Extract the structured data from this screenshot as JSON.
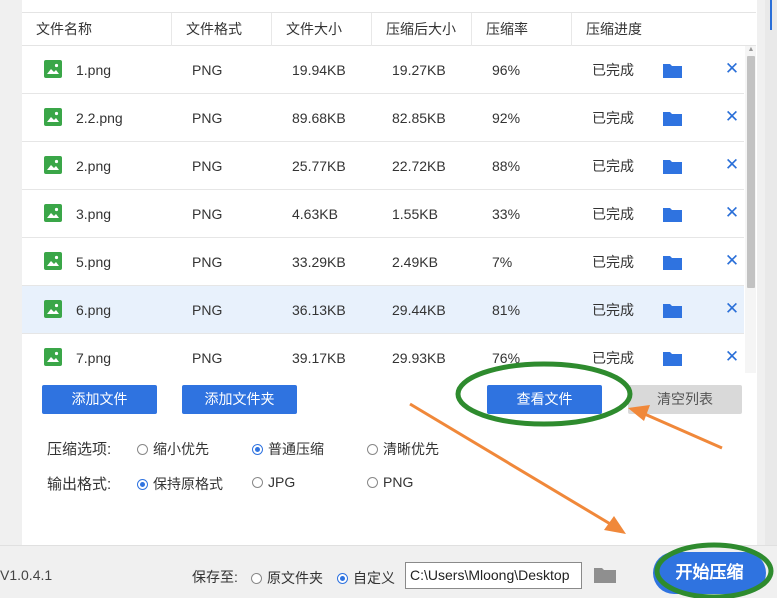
{
  "table": {
    "headers": [
      "文件名称",
      "文件格式",
      "文件大小",
      "压缩后大小",
      "压缩率",
      "压缩进度"
    ],
    "rows": [
      {
        "name": "1.png",
        "format": "PNG",
        "size": "19.94KB",
        "compressed": "19.27KB",
        "rate": "96%",
        "status": "已完成",
        "selected": false
      },
      {
        "name": "2.2.png",
        "format": "PNG",
        "size": "89.68KB",
        "compressed": "82.85KB",
        "rate": "92%",
        "status": "已完成",
        "selected": false
      },
      {
        "name": "2.png",
        "format": "PNG",
        "size": "25.77KB",
        "compressed": "22.72KB",
        "rate": "88%",
        "status": "已完成",
        "selected": false
      },
      {
        "name": "3.png",
        "format": "PNG",
        "size": "4.63KB",
        "compressed": "1.55KB",
        "rate": "33%",
        "status": "已完成",
        "selected": false
      },
      {
        "name": "5.png",
        "format": "PNG",
        "size": "33.29KB",
        "compressed": "2.49KB",
        "rate": "7%",
        "status": "已完成",
        "selected": false
      },
      {
        "name": "6.png",
        "format": "PNG",
        "size": "36.13KB",
        "compressed": "29.44KB",
        "rate": "81%",
        "status": "已完成",
        "selected": true
      },
      {
        "name": "7.png",
        "format": "PNG",
        "size": "39.17KB",
        "compressed": "29.93KB",
        "rate": "76%",
        "status": "已完成",
        "selected": false
      }
    ],
    "remove_symbol": "✕"
  },
  "actions": {
    "add_file": "添加文件",
    "add_folder": "添加文件夹",
    "view_files": "查看文件",
    "clear_list": "清空列表"
  },
  "options": {
    "compress_label": "压缩选项:",
    "compress_choices": [
      "缩小优先",
      "普通压缩",
      "清晰优先"
    ],
    "compress_selected": "普通压缩",
    "output_label": "输出格式:",
    "output_choices": [
      "保持原格式",
      "JPG",
      "PNG"
    ],
    "output_selected": "保持原格式"
  },
  "footer": {
    "version": "V1.0.4.1",
    "save_to_label": "保存至:",
    "save_choices": [
      "原文件夹",
      "自定义"
    ],
    "save_selected": "自定义",
    "path_value": "C:\\Users\\Mloong\\Desktop",
    "start_label": "开始压缩"
  },
  "colors": {
    "accent": "#2f73e0",
    "annotation_green": "#2e8b2e",
    "annotation_orange": "#f0883a",
    "file_icon": "#3aa648"
  }
}
